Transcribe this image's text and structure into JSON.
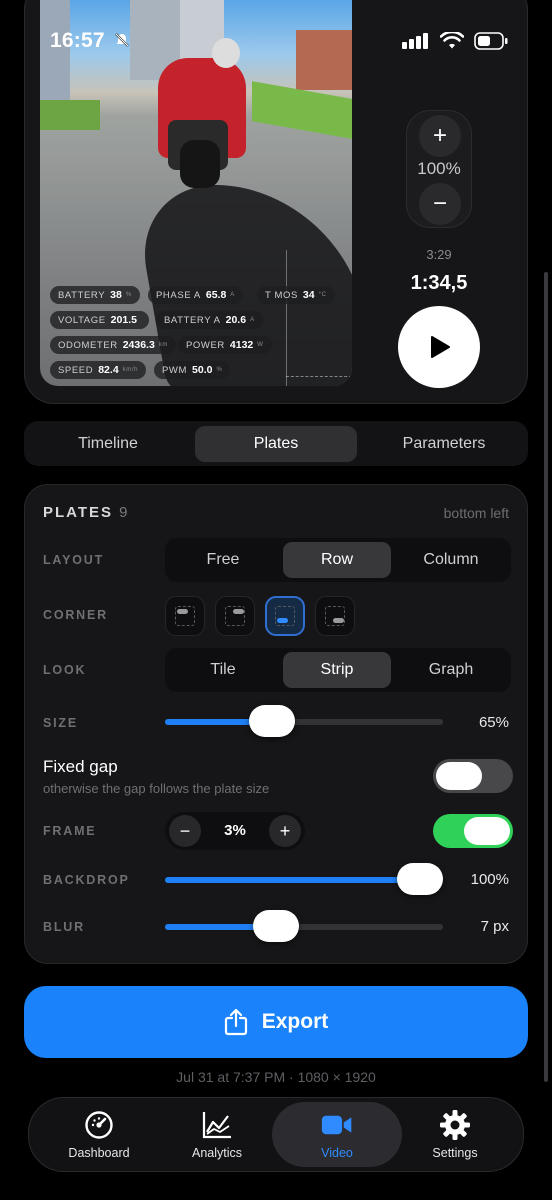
{
  "status_bar": {
    "time": "16:57"
  },
  "preview": {
    "plates": [
      {
        "label": "BATTERY",
        "value": "38",
        "unit": "%"
      },
      {
        "label": "PHASE A",
        "value": "65.8",
        "unit": "A"
      },
      {
        "label": "T MOS",
        "value": "34",
        "unit": "°C"
      },
      {
        "label": "VOLTAGE",
        "value": "201.5",
        "unit": ""
      },
      {
        "label": "BATTERY A",
        "value": "20.6",
        "unit": "A"
      },
      {
        "label": "ODOMETER",
        "value": "2436.3",
        "unit": "km"
      },
      {
        "label": "POWER",
        "value": "4132",
        "unit": "W"
      },
      {
        "label": "SPEED",
        "value": "82.4",
        "unit": "km/h"
      },
      {
        "label": "PWM",
        "value": "50.0",
        "unit": "%"
      }
    ],
    "zoom": {
      "plus": "+",
      "value": "100%",
      "minus": "−"
    },
    "duration_total": "3:29",
    "duration_current": "1:34,5"
  },
  "tabs": [
    {
      "label": "Timeline",
      "active": false
    },
    {
      "label": "Plates",
      "active": true
    },
    {
      "label": "Parameters",
      "active": false
    }
  ],
  "plates_panel": {
    "title": "PLATES",
    "count": "9",
    "position": "bottom left",
    "layout": {
      "label": "LAYOUT",
      "options": [
        "Free",
        "Row",
        "Column"
      ],
      "selected": "Row"
    },
    "corner": {
      "label": "CORNER",
      "options": [
        "top-left",
        "top-right",
        "bottom-left",
        "bottom-right"
      ],
      "selected": "bottom-left"
    },
    "look": {
      "label": "LOOK",
      "options": [
        "Tile",
        "Strip",
        "Graph"
      ],
      "selected": "Strip"
    },
    "size": {
      "label": "SIZE",
      "value": "65%",
      "fraction": 0.36
    },
    "fixed_gap": {
      "title": "Fixed gap",
      "subtitle": "otherwise the gap follows the plate size",
      "on": false
    },
    "frame": {
      "label": "FRAME",
      "minus": "−",
      "value": "3%",
      "plus": "+",
      "on": true
    },
    "backdrop": {
      "label": "BACKDROP",
      "value": "100%",
      "fraction": 1.0
    },
    "blur": {
      "label": "BLUR",
      "value": "7 px",
      "fraction": 0.38
    }
  },
  "export": {
    "label": "Export",
    "meta": "Jul 31 at 7:37 PM · 1080 × 1920"
  },
  "bottom_nav": [
    {
      "label": "Dashboard",
      "icon": "gauge-icon",
      "active": false
    },
    {
      "label": "Analytics",
      "icon": "chart-icon",
      "active": false
    },
    {
      "label": "Video",
      "icon": "video-camera-icon",
      "active": true
    },
    {
      "label": "Settings",
      "icon": "gear-icon",
      "active": false
    }
  ],
  "colors": {
    "accent": "#1a82fb",
    "toggle_on": "#30d158",
    "background": "#000000",
    "panel": "#161618"
  }
}
